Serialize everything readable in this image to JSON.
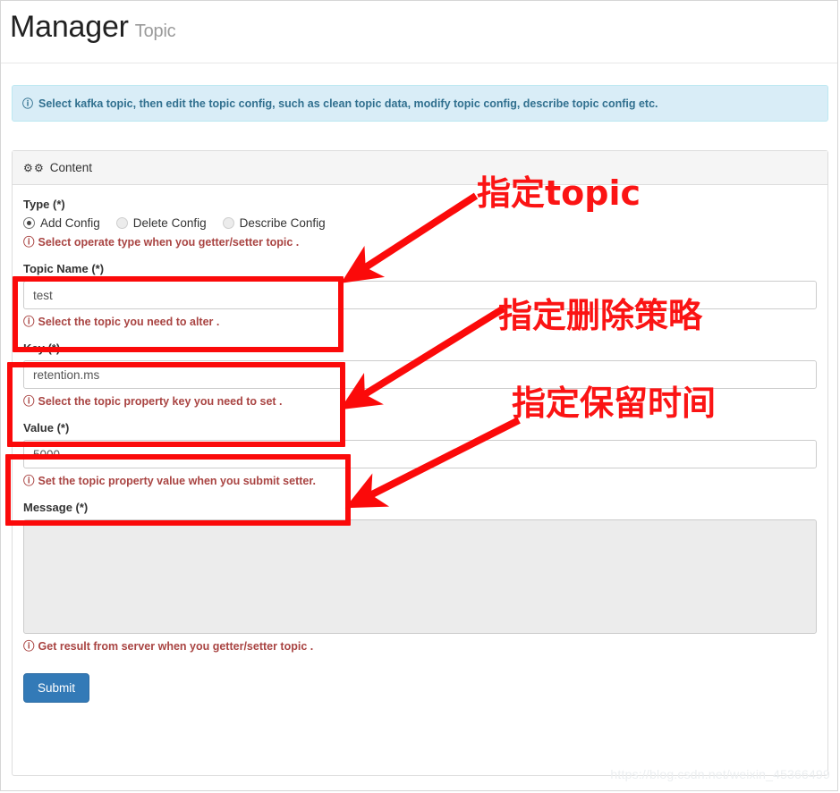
{
  "header": {
    "title": "Manager",
    "subtitle": "Topic"
  },
  "alert": {
    "icon": "info-circle-icon",
    "text": "Select kafka topic, then edit the topic config, such as clean topic data, modify topic config, describe topic config etc."
  },
  "panel": {
    "icon": "gears-icon",
    "heading": "Content"
  },
  "form": {
    "type": {
      "label": "Type (*)",
      "options": [
        {
          "label": "Add Config",
          "selected": true
        },
        {
          "label": "Delete Config",
          "selected": false
        },
        {
          "label": "Describe Config",
          "selected": false
        }
      ],
      "help": "Select operate type when you getter/setter topic ."
    },
    "topic_name": {
      "label": "Topic Name (*)",
      "value": "test",
      "placeholder": "",
      "help": "Select the topic you need to alter ."
    },
    "key": {
      "label": "Key (*)",
      "value": "retention.ms",
      "placeholder": "",
      "help": "Select the topic property key you need to set ."
    },
    "value": {
      "label": "Value (*)",
      "value": "5000",
      "placeholder": "",
      "help": "Set the topic property value when you submit setter."
    },
    "message": {
      "label": "Message (*)",
      "value": "",
      "placeholder": "",
      "help": "Get result from server when you getter/setter topic ."
    },
    "submit_label": "Submit"
  },
  "annotations": {
    "labels": [
      {
        "text": "指定topic"
      },
      {
        "text": "指定删除策略"
      },
      {
        "text": "指定保留时间"
      }
    ]
  },
  "watermark": "https://blog.csdn.net/weixin_45366499"
}
